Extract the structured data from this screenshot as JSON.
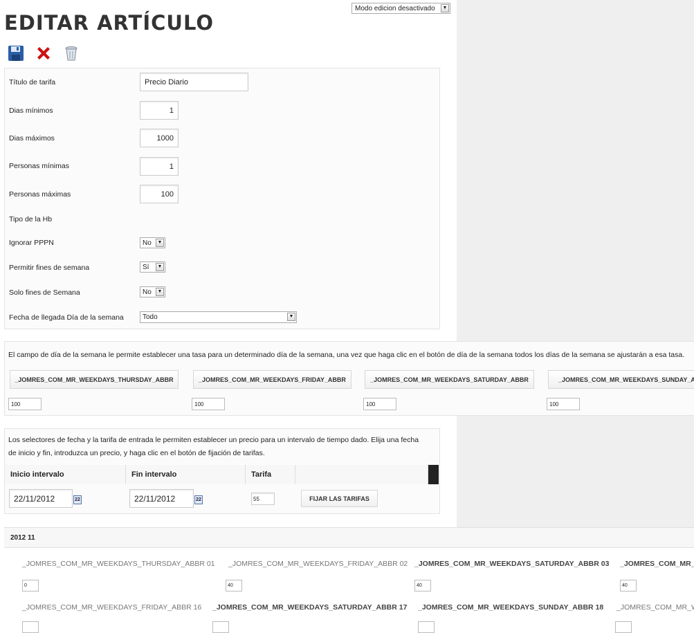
{
  "page": {
    "title": "EDITAR ARTÍCULO",
    "mode_select": "Modo edicion desactivado"
  },
  "toolbar": {
    "icons": [
      "save-icon",
      "cancel-icon",
      "delete-icon"
    ],
    "colors": {
      "save": "#2a5ea8",
      "cancel": "#cc1111"
    }
  },
  "form": {
    "rate_title": {
      "label": "Título de tarifa",
      "value": "Precio Diario"
    },
    "min_days": {
      "label": "Dias mínimos",
      "value": "1"
    },
    "max_days": {
      "label": "Dias máximos",
      "value": "1000"
    },
    "min_people": {
      "label": "Personas mínimas",
      "value": "1"
    },
    "max_people": {
      "label": "Personas máximas",
      "value": "100"
    },
    "room_type": {
      "label": "Tipo de la Hb"
    },
    "ignore_pppn": {
      "label": "Ignorar PPPN",
      "value": "No"
    },
    "allow_weekends": {
      "label": "Permitir fines de semana",
      "value": "Sí"
    },
    "weekends_only": {
      "label": "Solo fines de Semana",
      "value": "No"
    },
    "arrival_weekday": {
      "label": "Fecha de llegada Día de la semana",
      "value": "Todo"
    }
  },
  "weekdays": {
    "description": "El campo de día de la semana le permite establecer una tasa para un determinado día de la semana, una vez que haga clic en el botón de día de la semana todos los días de la semana se ajustarán a esa tasa.",
    "buttons": [
      {
        "label": "_JOMRES_COM_MR_WEEKDAYS_THURSDAY_ABBR",
        "value": "100"
      },
      {
        "label": "_JOMRES_COM_MR_WEEKDAYS_FRIDAY_ABBR",
        "value": "100"
      },
      {
        "label": "_JOMRES_COM_MR_WEEKDAYS_SATURDAY_ABBR",
        "value": "100"
      },
      {
        "label": "_JOMRES_COM_MR_WEEKDAYS_SUNDAY_ABBR",
        "value": "100"
      }
    ]
  },
  "interval": {
    "description_line1": "Los selectores de fecha y la tarifa de entrada le permiten establecer un precio para un intervalo de tiempo dado. Elija una fecha",
    "description_line2": "de inicio y fin, introduzca un precio, y haga clic en el botón de fijación de tarifas.",
    "headers": {
      "start": "Inicio intervalo",
      "end": "Fin intervalo",
      "rate": "Tarifa"
    },
    "start_value": "22/11/2012",
    "end_value": "22/11/2012",
    "rate_value": "55",
    "calendar_icon_text": "22",
    "set_button": "FIJAR LAS TARIFAS"
  },
  "calendar": {
    "month_label": "2012 11",
    "row1": [
      {
        "label": "_JOMRES_COM_MR_WEEKDAYS_THURSDAY_ABBR 01",
        "value": "0",
        "weekend": false
      },
      {
        "label": "_JOMRES_COM_MR_WEEKDAYS_FRIDAY_ABBR 02",
        "value": "40",
        "weekend": false
      },
      {
        "label": "_JOMRES_COM_MR_WEEKDAYS_SATURDAY_ABBR 03",
        "value": "40",
        "weekend": true
      },
      {
        "label": "_JOMRES_COM_MR_",
        "value": "40",
        "weekend": true
      }
    ],
    "row2": [
      {
        "label": "_JOMRES_COM_MR_WEEKDAYS_FRIDAY_ABBR 16",
        "weekend": false
      },
      {
        "label": "_JOMRES_COM_MR_WEEKDAYS_SATURDAY_ABBR 17",
        "weekend": true
      },
      {
        "label": "_JOMRES_COM_MR_WEEKDAYS_SUNDAY_ABBR 18",
        "weekend": true
      },
      {
        "label": "_JOMRES_COM_MR_W",
        "weekend": false
      }
    ]
  }
}
